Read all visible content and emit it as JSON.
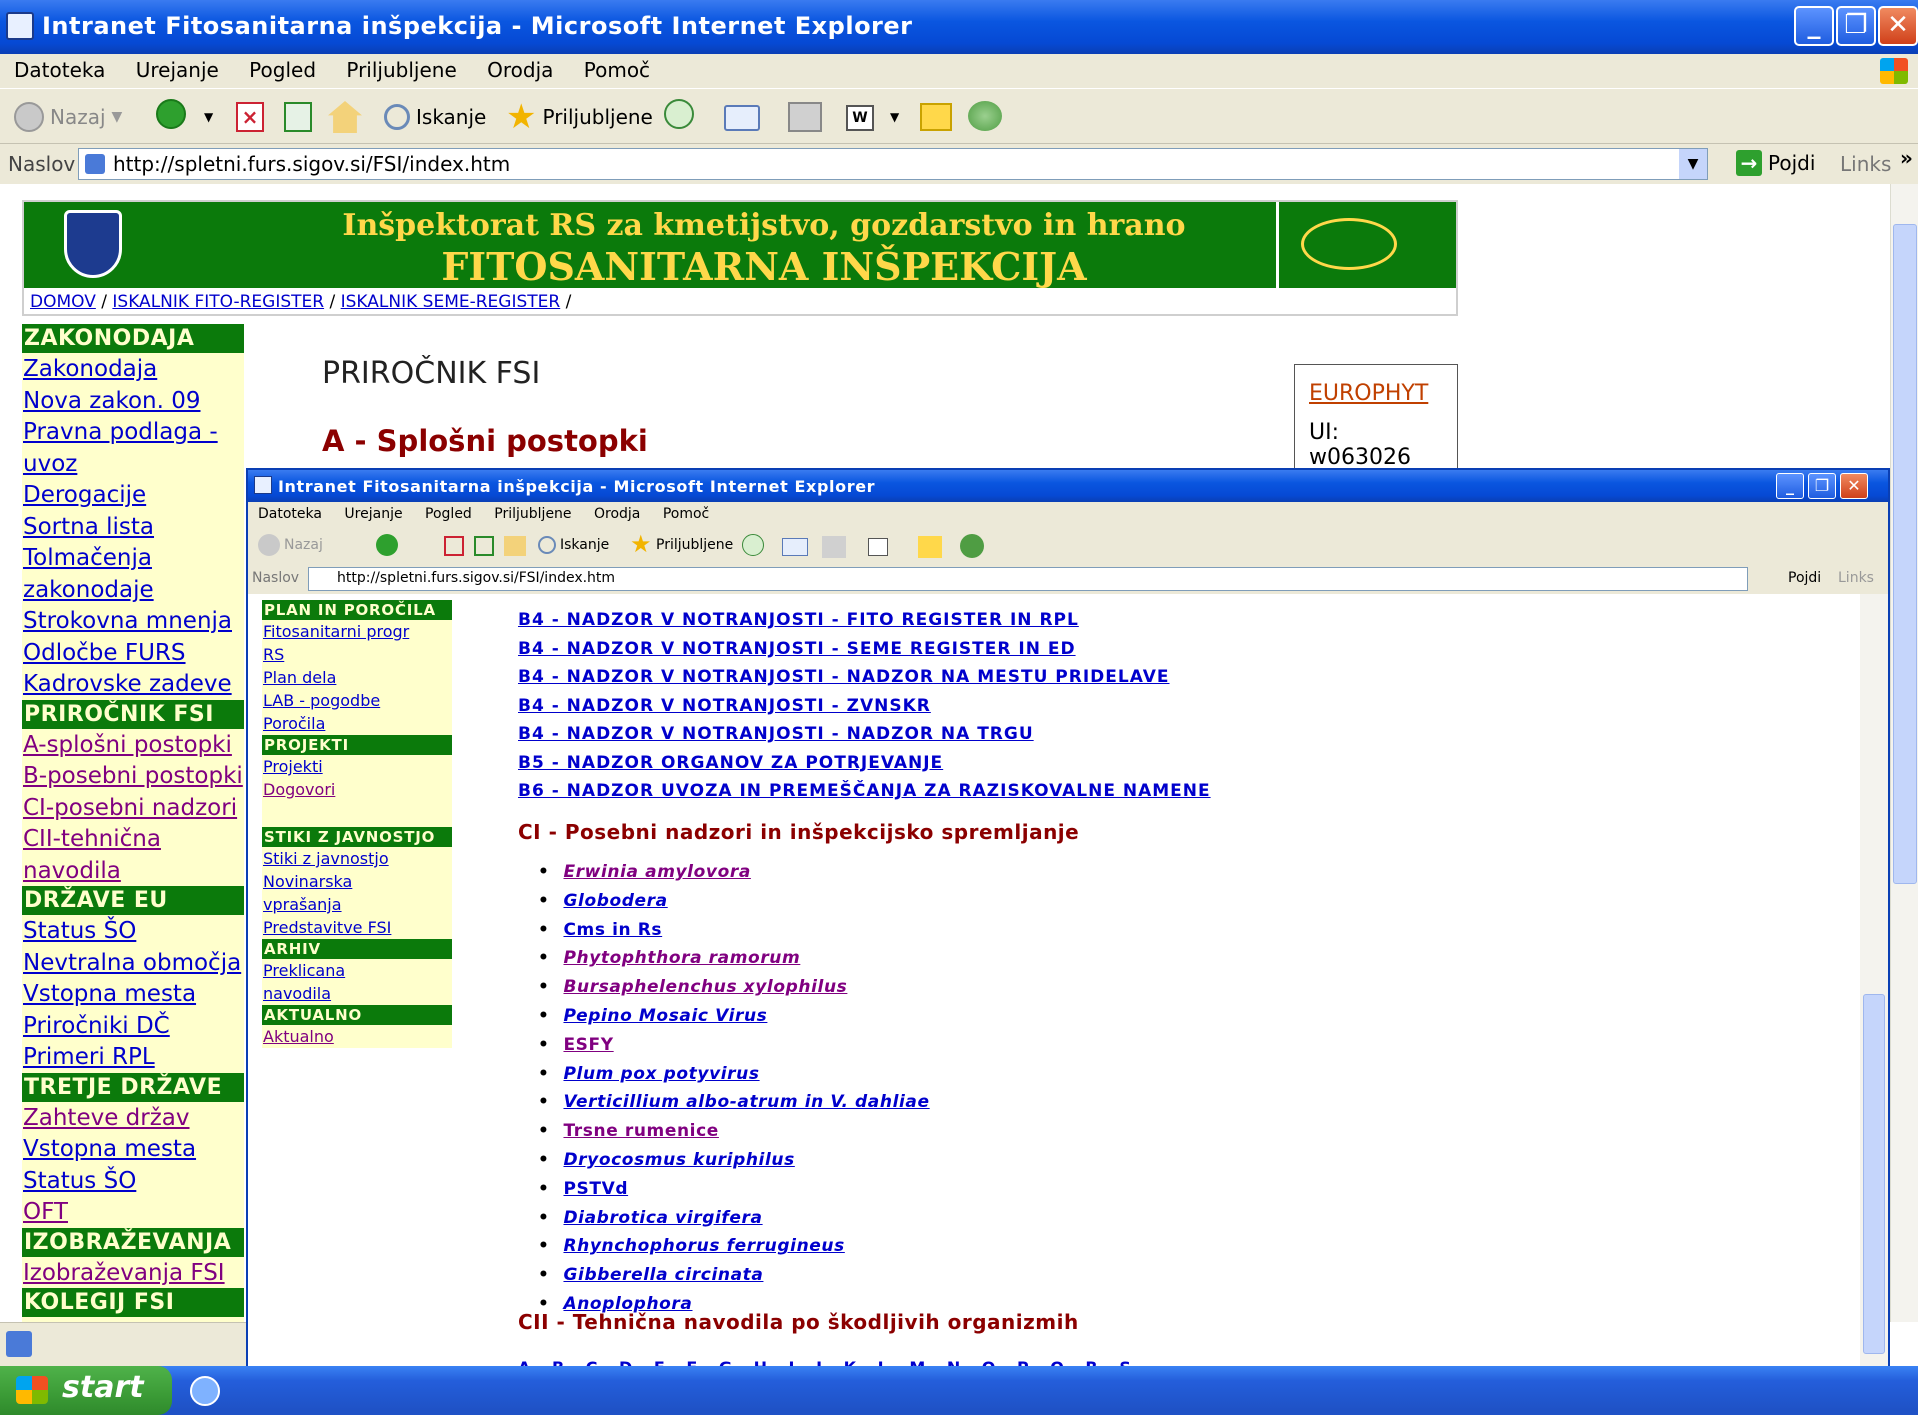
{
  "window": {
    "title": "Intranet Fitosanitarna inšpekcija - Microsoft Internet Explorer",
    "min": "_",
    "max": "❐",
    "close": "✕"
  },
  "menu": [
    "Datoteka",
    "Urejanje",
    "Pogled",
    "Priljubljene",
    "Orodja",
    "Pomoč"
  ],
  "toolbar": {
    "back": "Nazaj",
    "search": "Iskanje",
    "favorites": "Priljubljene"
  },
  "address": {
    "label": "Naslov",
    "url": "http://spletni.furs.sigov.si/FSI/index.htm",
    "go": "Pojdi",
    "links": "Links",
    "chev": "»"
  },
  "header": {
    "line1": "Inšpektorat RS za kmetijstvo, gozdarstvo in hrano",
    "line2": "FITOSANITARNA INŠPEKCIJA",
    "breadcrumb": [
      "DOMOV",
      "ISKALNIK FITO-REGISTER",
      "ISKALNIK SEME-REGISTER"
    ],
    "sep": "/"
  },
  "leftnav": [
    {
      "t": "h",
      "label": "ZAKONODAJA"
    },
    {
      "t": "a",
      "label": "Zakonodaja"
    },
    {
      "t": "a",
      "label": "Nova zakon. 09"
    },
    {
      "t": "a",
      "label": "Pravna podlaga -"
    },
    {
      "t": "a",
      "label": "uvoz"
    },
    {
      "t": "a",
      "label": "Derogacije"
    },
    {
      "t": "a",
      "label": "Sortna lista"
    },
    {
      "t": "a",
      "label": "Tolmačenja"
    },
    {
      "t": "a",
      "label": "zakonodaje"
    },
    {
      "t": "a",
      "label": "Strokovna mnenja"
    },
    {
      "t": "a",
      "label": "Odločbe FURS"
    },
    {
      "t": "a",
      "label": "Kadrovske zadeve"
    },
    {
      "t": "h",
      "label": "PRIROČNIK FSI"
    },
    {
      "t": "v",
      "label": "A-splošni postopki"
    },
    {
      "t": "v",
      "label": "B-posebni postopki"
    },
    {
      "t": "v",
      "label": "CI-posebni nadzori"
    },
    {
      "t": "v",
      "label": "CII-tehnična"
    },
    {
      "t": "v",
      "label": "navodila"
    },
    {
      "t": "h",
      "label": "DRŽAVE EU"
    },
    {
      "t": "a",
      "label": "Status ŠO"
    },
    {
      "t": "a",
      "label": "Nevtralna območja"
    },
    {
      "t": "a",
      "label": "Vstopna mesta"
    },
    {
      "t": "a",
      "label": "Priročniki DČ"
    },
    {
      "t": "a",
      "label": "Primeri RPL"
    },
    {
      "t": "h",
      "label": "TRETJE DRŽAVE"
    },
    {
      "t": "v",
      "label": "Zahteve držav"
    },
    {
      "t": "a",
      "label": "Vstopna mesta"
    },
    {
      "t": "a",
      "label": "Status ŠO"
    },
    {
      "t": "v",
      "label": "OFT"
    },
    {
      "t": "h",
      "label": "IZOBRAŽEVANJA"
    },
    {
      "t": "v",
      "label": "Izobraževanja FSI"
    },
    {
      "t": "h",
      "label": "KOLEGIJ FSI"
    }
  ],
  "main": {
    "page_title": "PRIROČNIK FSI",
    "section_a": "A - Splošni postopki",
    "europhyt": {
      "link": "EUROPHYT",
      "ui_label": "UI:",
      "ui_value": "w063026"
    }
  },
  "overlay": {
    "leftnav": [
      {
        "t": "h",
        "label": "PLAN IN POROČILA"
      },
      {
        "t": "a",
        "label": "Fitosanitarni progr"
      },
      {
        "t": "a",
        "label": "RS"
      },
      {
        "t": "a",
        "label": "Plan dela"
      },
      {
        "t": "a",
        "label": "LAB - pogodbe"
      },
      {
        "t": "a",
        "label": "Poročila"
      },
      {
        "t": "h",
        "label": "PROJEKTI"
      },
      {
        "t": "a",
        "label": "Projekti"
      },
      {
        "t": "v",
        "label": "Dogovori"
      },
      {
        "t": "s",
        "label": ""
      },
      {
        "t": "h",
        "label": "STIKI Z JAVNOSTJO"
      },
      {
        "t": "a",
        "label": "Stiki z javnostjo"
      },
      {
        "t": "a",
        "label": "Novinarska"
      },
      {
        "t": "a",
        "label": "vprašanja"
      },
      {
        "t": "a",
        "label": "Predstavitve FSI"
      },
      {
        "t": "h",
        "label": "ARHIV"
      },
      {
        "t": "a",
        "label": "Preklicana"
      },
      {
        "t": "a",
        "label": "navodila"
      },
      {
        "t": "h",
        "label": "AKTUALNO"
      },
      {
        "t": "v",
        "label": "Aktualno"
      }
    ],
    "b_links": [
      "B4 - NADZOR V NOTRANJOSTI - FITO REGISTER IN RPL",
      "B4 - NADZOR V NOTRANJOSTI - SEME REGISTER IN ED",
      "B4 - NADZOR V NOTRANJOSTI - NADZOR NA MESTU PRIDELAVE",
      "B4 - NADZOR V NOTRANJOSTI - ZVNSKR",
      "B4 - NADZOR V NOTRANJOSTI - NADZOR NA TRGU",
      "B5 - NADZOR ORGANOV ZA POTRJEVANJE",
      "B6 - NADZOR UVOZA IN PREMEŠČANJA ZA RAZISKOVALNE NAMENE"
    ],
    "ci_heading": "CI - Posebni nadzori in inšpekcijsko spremljanje",
    "ci_items": [
      {
        "label": "Erwinia amylovora",
        "cls": "v"
      },
      {
        "label": "Globodera",
        "cls": ""
      },
      {
        "label": "Cms in Rs",
        "cls": "n"
      },
      {
        "label": "Phytophthora ramorum",
        "cls": "v"
      },
      {
        "label": "Bursaphelenchus xylophilus",
        "cls": "v"
      },
      {
        "label": "Pepino Mosaic Virus",
        "cls": ""
      },
      {
        "label": "ESFY",
        "cls": "v n"
      },
      {
        "label": "Plum pox potyvirus",
        "cls": ""
      },
      {
        "label": "Verticillium albo-atrum in V. dahliae",
        "cls": ""
      },
      {
        "label": "Trsne rumenice",
        "cls": "v n"
      },
      {
        "label": "Dryocosmus kuriphilus",
        "cls": ""
      },
      {
        "label": "PSTVd",
        "cls": "n"
      },
      {
        "label": "Diabrotica virgifera",
        "cls": ""
      },
      {
        "label": "Rhynchophorus ferrugineus",
        "cls": ""
      },
      {
        "label": "Gibberella circinata",
        "cls": ""
      },
      {
        "label": "Anoplophora",
        "cls": ""
      }
    ],
    "cii_heading": "CII - Tehnična navodila po škodljivih organizmih",
    "alphabet": "A B C D E F G H I J K L M N O P Q R S"
  },
  "taskbar": {
    "start": "start"
  },
  "colors": {
    "header_green": "#0b7a0b",
    "header_text": "#ffd84a",
    "nav_bg": "#ffffcc",
    "link": "#0000cc",
    "visited": "#800080",
    "heading_red": "#8b0000"
  }
}
